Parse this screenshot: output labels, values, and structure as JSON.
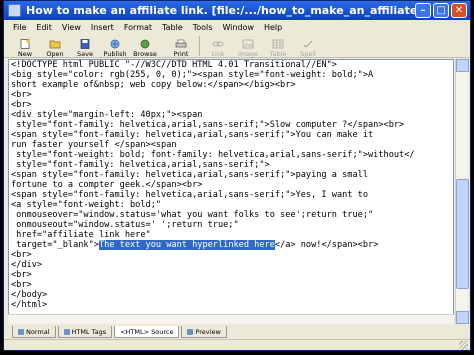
{
  "window": {
    "title": "How to make an affiliate link. [file:/.../how_to_make_an_affiliate_link.html] - Composer"
  },
  "menu": [
    "File",
    "Edit",
    "View",
    "Insert",
    "Format",
    "Table",
    "Tools",
    "Window",
    "Help"
  ],
  "toolbar": {
    "new": "New",
    "open": "Open",
    "save": "Save",
    "publish": "Publish",
    "browse": "Browse",
    "print": "Print",
    "link": "Link",
    "image": "Image",
    "table": "Table",
    "spell": "Spell"
  },
  "editor": {
    "lines": [
      "<!DOCTYPE html PUBLIC \"-//W3C//DTD HTML 4.01 Transitional//EN\">",
      "<big style=\"color: rgb(255, 0, 0);\"><span style=\"font-weight: bold;\">A",
      "short example of&nbsp; web copy below:</span></big><br>",
      "<br>",
      "<br>",
      "<div style=\"margin-left: 40px;\"><span",
      " style=\"font-family: helvetica,arial,sans-serif;\">Slow computer ?</span><br>",
      "<span style=\"font-family: helvetica,arial,sans-serif;\">You can make it",
      "run faster yourself </span><span",
      " style=\"font-weight: bold; font-family: helvetica,arial,sans-serif;\">without</",
      " style=\"font-family: helvetica,arial,sans-serif;\">",
      "<span style=\"font-family: helvetica,arial,sans-serif;\">paying a small",
      "fortune to a compter geek.</span><br>",
      "<span style=\"font-family: helvetica,arial,sans-serif;\">Yes, I want to",
      "<a style=\"font-weight: bold;\"",
      " onmouseover=\"window.status='what you want folks to see';return true;\"",
      " onmouseout=\"window.status=' ';return true;\"",
      " href=\"affiliate link here\"",
      " target=\"_blank\">The text you want hyperlinked here</a> now!</span><br>",
      "<br>",
      "</div>",
      "<br>",
      "<br>",
      "</body>",
      "</html>"
    ],
    "highlight": {
      "line": 18,
      "before": " target=\"_blank\">",
      "selected": "The text you want hyperlinked here",
      "after": "</a> now!</span><br>"
    }
  },
  "modes": {
    "normal": "Normal",
    "html_tags": "HTML Tags",
    "source": "<HTML> Source",
    "preview": "Preview",
    "active": "source"
  }
}
